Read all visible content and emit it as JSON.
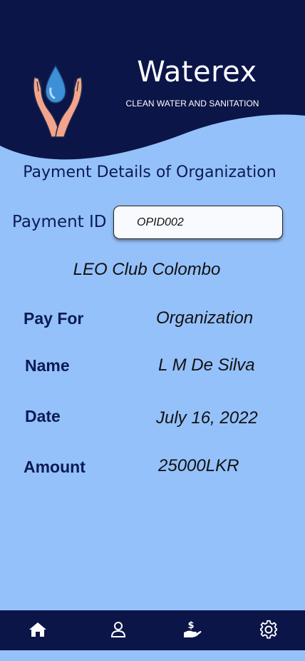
{
  "app": {
    "title": "Waterex",
    "subtitle": "CLEAN WATER AND SANITATION"
  },
  "page": {
    "title": "Payment Details of Organization"
  },
  "payment_id": {
    "label": "Payment ID",
    "value": "OPID002"
  },
  "organization_name": "LEO Club Colombo",
  "details": {
    "pay_for": {
      "label": "Pay For",
      "value": "Organization"
    },
    "name": {
      "label": "Name",
      "value": "L M De Silva"
    },
    "date": {
      "label": "Date",
      "value": "July 16, 2022"
    },
    "amount": {
      "label": "Amount",
      "value": "25000LKR"
    }
  },
  "nav": {
    "items": [
      {
        "icon": "home-icon"
      },
      {
        "icon": "user-icon"
      },
      {
        "icon": "donate-icon"
      },
      {
        "icon": "settings-icon"
      }
    ]
  },
  "colors": {
    "background": "#95c1fb",
    "header": "#0b1548",
    "nav": "#0b1548",
    "text_dark": "#0b1b54"
  }
}
